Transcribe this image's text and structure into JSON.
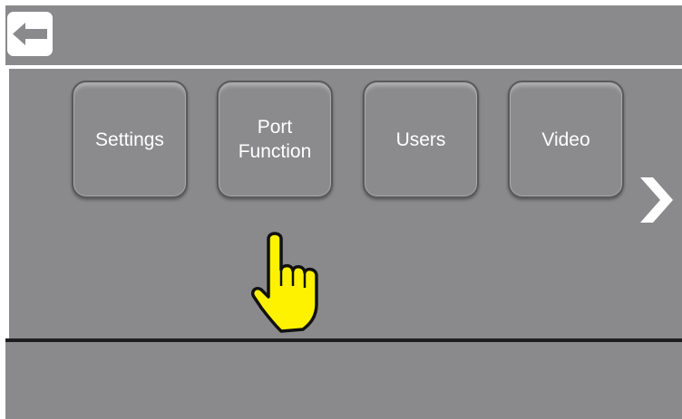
{
  "toolbar": {
    "back_icon": "arrow-left-icon"
  },
  "menu": {
    "tiles": [
      {
        "label": "Settings"
      },
      {
        "label": "Port\nFunction"
      },
      {
        "label": "Users"
      },
      {
        "label": "Video"
      }
    ],
    "next_icon": "chevron-right-icon"
  },
  "overlay": {
    "pointer_icon": "pointing-hand-icon",
    "pointer_color": "#fff200"
  },
  "colors": {
    "panel": "#8a8a8c",
    "divider_light": "#ffffff",
    "divider_dark": "#1e1e1e",
    "label": "#ffffff"
  }
}
